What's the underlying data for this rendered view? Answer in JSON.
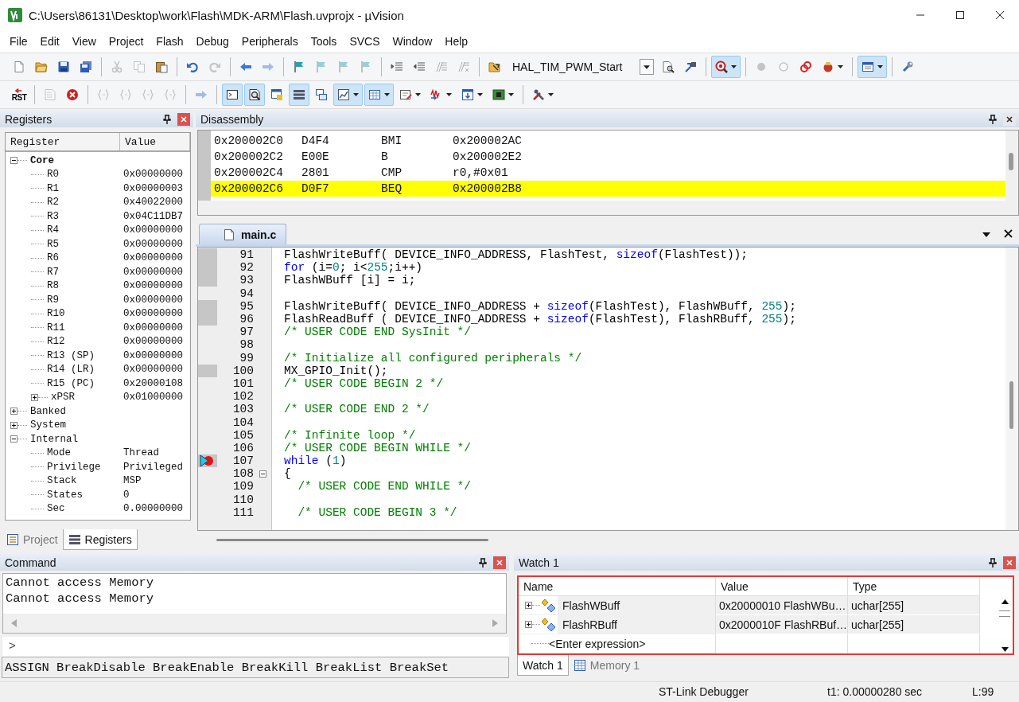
{
  "window": {
    "title": "C:\\Users\\86131\\Desktop\\work\\Flash\\MDK-ARM\\Flash.uvprojx - µVision"
  },
  "menu": [
    {
      "label": "File"
    },
    {
      "label": "Edit"
    },
    {
      "label": "View"
    },
    {
      "label": "Project"
    },
    {
      "label": "Flash"
    },
    {
      "label": "Debug"
    },
    {
      "label": "Peripherals"
    },
    {
      "label": "Tools"
    },
    {
      "label": "SVCS"
    },
    {
      "label": "Window"
    },
    {
      "label": "Help"
    }
  ],
  "toolbar_1": [
    {
      "kind": "page",
      "disabled": false,
      "on": false,
      "dropdown": false
    },
    {
      "kind": "folder",
      "disabled": false,
      "on": false,
      "dropdown": false
    },
    {
      "kind": "disk",
      "disabled": false,
      "on": false,
      "dropdown": false
    },
    {
      "kind": "disks",
      "disabled": false,
      "on": false,
      "dropdown": false
    },
    {
      "kind": "sep"
    },
    {
      "kind": "scissors",
      "disabled": true,
      "on": false,
      "dropdown": false
    },
    {
      "kind": "copy",
      "disabled": true,
      "on": false,
      "dropdown": false
    },
    {
      "kind": "clipboard",
      "disabled": false,
      "on": false,
      "dropdown": false
    },
    {
      "kind": "sep"
    },
    {
      "kind": "undo",
      "disabled": false,
      "on": false,
      "dropdown": false
    },
    {
      "kind": "redo",
      "disabled": true,
      "on": false,
      "dropdown": false
    },
    {
      "kind": "sep"
    },
    {
      "kind": "left",
      "disabled": false,
      "on": false,
      "dropdown": false
    },
    {
      "kind": "right",
      "disabled": true,
      "on": false,
      "dropdown": false
    },
    {
      "kind": "sep"
    },
    {
      "kind": "flag",
      "disabled": false,
      "on": false,
      "dropdown": false
    },
    {
      "kind": "flag",
      "disabled": true,
      "on": false,
      "dropdown": false
    },
    {
      "kind": "flag",
      "disabled": true,
      "on": false,
      "dropdown": false
    },
    {
      "kind": "flag",
      "disabled": true,
      "on": false,
      "dropdown": false
    },
    {
      "kind": "sep"
    },
    {
      "kind": "indent",
      "disabled": false,
      "on": false,
      "dropdown": false
    },
    {
      "kind": "unindent",
      "disabled": false,
      "on": false,
      "dropdown": false
    },
    {
      "kind": "comment",
      "disabled": true,
      "on": false,
      "dropdown": false
    },
    {
      "kind": "uncomment",
      "disabled": true,
      "on": false,
      "dropdown": false
    },
    {
      "kind": "sep"
    },
    {
      "kind": "findfolder",
      "disabled": false,
      "on": false,
      "dropdown": false
    },
    {
      "kind": "combo",
      "text": "HAL_TIM_PWM_Start"
    },
    {
      "kind": "finddoc",
      "disabled": false,
      "on": false,
      "dropdown": false
    },
    {
      "kind": "jump",
      "disabled": false,
      "on": false,
      "dropdown": false
    },
    {
      "kind": "sep"
    },
    {
      "kind": "debug",
      "disabled": false,
      "on": true,
      "dropdown": true
    },
    {
      "kind": "sep"
    },
    {
      "kind": "dot",
      "disabled": true,
      "on": false,
      "dropdown": false
    },
    {
      "kind": "ring",
      "disabled": true,
      "on": false,
      "dropdown": false
    },
    {
      "kind": "rings",
      "disabled": false,
      "on": false,
      "dropdown": false
    },
    {
      "kind": "hand",
      "disabled": false,
      "on": false,
      "dropdown": true
    },
    {
      "kind": "sep"
    },
    {
      "kind": "window",
      "disabled": false,
      "on": true,
      "dropdown": true
    },
    {
      "kind": "sep"
    },
    {
      "kind": "wrench",
      "disabled": false,
      "on": false,
      "dropdown": false
    }
  ],
  "toolbar_2": [
    {
      "kind": "rst",
      "label": "RST",
      "disabled": false,
      "on": false,
      "dropdown": false
    },
    {
      "kind": "sep"
    },
    {
      "kind": "listdoc",
      "disabled": true,
      "on": false,
      "dropdown": false
    },
    {
      "kind": "stop",
      "disabled": false,
      "on": false,
      "dropdown": false
    },
    {
      "kind": "sep"
    },
    {
      "kind": "braces",
      "disabled": true,
      "on": false,
      "dropdown": false
    },
    {
      "kind": "braces",
      "disabled": true,
      "on": false,
      "dropdown": false
    },
    {
      "kind": "braces",
      "disabled": true,
      "on": false,
      "dropdown": false
    },
    {
      "kind": "braces",
      "disabled": true,
      "on": false,
      "dropdown": false
    },
    {
      "kind": "sep"
    },
    {
      "kind": "right",
      "disabled": true,
      "on": false,
      "dropdown": false
    },
    {
      "kind": "sep"
    },
    {
      "kind": "terminal",
      "disabled": false,
      "on": true,
      "dropdown": false
    },
    {
      "kind": "magdoc",
      "disabled": false,
      "on": true,
      "dropdown": false
    },
    {
      "kind": "swin",
      "disabled": false,
      "on": false,
      "dropdown": false
    },
    {
      "kind": "bars",
      "disabled": false,
      "on": true,
      "dropdown": false
    },
    {
      "kind": "windows",
      "disabled": false,
      "on": false,
      "dropdown": false
    },
    {
      "kind": "chart",
      "disabled": false,
      "on": true,
      "dropdown": true
    },
    {
      "kind": "grid",
      "disabled": false,
      "on": true,
      "dropdown": true
    },
    {
      "kind": "editdoc",
      "disabled": false,
      "on": false,
      "dropdown": true
    },
    {
      "kind": "wave",
      "disabled": false,
      "on": false,
      "dropdown": true
    },
    {
      "kind": "memdoc",
      "disabled": false,
      "on": false,
      "dropdown": true
    },
    {
      "kind": "chip",
      "disabled": false,
      "on": false,
      "dropdown": true
    },
    {
      "kind": "sep"
    },
    {
      "kind": "tools",
      "disabled": false,
      "on": false,
      "dropdown": true
    }
  ],
  "registers": {
    "title": "Registers",
    "active": true,
    "columns": [
      "Register",
      "Value"
    ],
    "tree": [
      {
        "name": "Core",
        "expanded": true,
        "emphasized": true,
        "children": [
          {
            "name": "R0",
            "value": "0x00000000"
          },
          {
            "name": "R1",
            "value": "0x00000003"
          },
          {
            "name": "R2",
            "value": "0x40022000"
          },
          {
            "name": "R3",
            "value": "0x04C11DB7"
          },
          {
            "name": "R4",
            "value": "0x00000000"
          },
          {
            "name": "R5",
            "value": "0x00000000"
          },
          {
            "name": "R6",
            "value": "0x00000000"
          },
          {
            "name": "R7",
            "value": "0x00000000"
          },
          {
            "name": "R8",
            "value": "0x00000000"
          },
          {
            "name": "R9",
            "value": "0x00000000"
          },
          {
            "name": "R10",
            "value": "0x00000000"
          },
          {
            "name": "R11",
            "value": "0x00000000"
          },
          {
            "name": "R12",
            "value": "0x00000000"
          },
          {
            "name": "R13 (SP)",
            "value": "0x00000000"
          },
          {
            "name": "R14 (LR)",
            "value": "0x00000000"
          },
          {
            "name": "R15 (PC)",
            "value": "0x20000108"
          },
          {
            "name": "xPSR",
            "value": "0x01000000",
            "expanded": false
          }
        ]
      },
      {
        "name": "Banked",
        "expanded": false,
        "emphasized": false
      },
      {
        "name": "System",
        "expanded": false,
        "emphasized": false
      },
      {
        "name": "Internal",
        "expanded": true,
        "emphasized": false,
        "children": [
          {
            "name": "Mode",
            "value": "Thread"
          },
          {
            "name": "Privilege",
            "value": "Privileged"
          },
          {
            "name": "Stack",
            "value": "MSP"
          },
          {
            "name": "States",
            "value": "0"
          },
          {
            "name": "Sec",
            "value": "0.00000000"
          }
        ]
      }
    ],
    "tabs": [
      {
        "label": "Project",
        "kind": "project",
        "selected": false
      },
      {
        "label": "Registers",
        "kind": "registers",
        "selected": true
      }
    ]
  },
  "disassembly": {
    "title": "Disassembly",
    "active": false,
    "rows": [
      {
        "address": "0x200002C0",
        "opcode": "D4F4",
        "mnemonic": "BMI",
        "operands": "0x200002AC",
        "current": false
      },
      {
        "address": "0x200002C2",
        "opcode": "E00E",
        "mnemonic": "B",
        "operands": "0x200002E2",
        "current": false
      },
      {
        "address": "0x200002C4",
        "opcode": "2801",
        "mnemonic": "CMP",
        "operands": "r0,#0x01",
        "current": false
      },
      {
        "address": "0x200002C6",
        "opcode": "D0F7",
        "mnemonic": "BEQ",
        "operands": "0x200002B8",
        "current": true
      }
    ]
  },
  "editor": {
    "tabs": [
      {
        "label": "main.c",
        "selected": true
      }
    ],
    "lines": [
      {
        "number": "91",
        "executable": true,
        "breakpoint": false,
        "current": false,
        "fold": false,
        "tokens": [
          {
            "kind": "plain",
            "text": "FlashWriteBuff( DEVICE_INFO_ADDRESS, FlashTest, "
          },
          {
            "kind": "keyword",
            "text": "sizeof"
          },
          {
            "kind": "plain",
            "text": "(FlashTest));"
          }
        ]
      },
      {
        "number": "92",
        "executable": true,
        "breakpoint": false,
        "current": false,
        "fold": false,
        "tokens": [
          {
            "kind": "keyword",
            "text": "for"
          },
          {
            "kind": "plain",
            "text": " (i="
          },
          {
            "kind": "number",
            "text": "0"
          },
          {
            "kind": "plain",
            "text": "; i<"
          },
          {
            "kind": "number",
            "text": "255"
          },
          {
            "kind": "plain",
            "text": ";i++)"
          }
        ]
      },
      {
        "number": "93",
        "executable": true,
        "breakpoint": false,
        "current": false,
        "fold": false,
        "tokens": [
          {
            "kind": "plain",
            "text": "FlashWBuff [i] = i;"
          }
        ]
      },
      {
        "number": "94",
        "executable": false,
        "breakpoint": false,
        "current": false,
        "fold": false
      },
      {
        "number": "95",
        "executable": true,
        "breakpoint": false,
        "current": false,
        "fold": false,
        "tokens": [
          {
            "kind": "plain",
            "text": "FlashWriteBuff( DEVICE_INFO_ADDRESS + "
          },
          {
            "kind": "keyword",
            "text": "sizeof"
          },
          {
            "kind": "plain",
            "text": "(FlashTest), FlashWBuff, "
          },
          {
            "kind": "number",
            "text": "255"
          },
          {
            "kind": "plain",
            "text": ");"
          }
        ]
      },
      {
        "number": "96",
        "executable": true,
        "breakpoint": false,
        "current": false,
        "fold": false,
        "tokens": [
          {
            "kind": "plain",
            "text": "FlashReadBuff ( DEVICE_INFO_ADDRESS + "
          },
          {
            "kind": "keyword",
            "text": "sizeof"
          },
          {
            "kind": "plain",
            "text": "(FlashTest), FlashRBuff, "
          },
          {
            "kind": "number",
            "text": "255"
          },
          {
            "kind": "plain",
            "text": ");"
          }
        ]
      },
      {
        "number": "97",
        "executable": false,
        "breakpoint": false,
        "current": false,
        "fold": false,
        "tokens": [
          {
            "kind": "comment",
            "text": "/* USER CODE END SysInit */"
          }
        ]
      },
      {
        "number": "98",
        "executable": false,
        "breakpoint": false,
        "current": false,
        "fold": false
      },
      {
        "number": "99",
        "executable": false,
        "breakpoint": false,
        "current": false,
        "fold": false,
        "tokens": [
          {
            "kind": "comment",
            "text": "/* Initialize all configured peripherals */"
          }
        ]
      },
      {
        "number": "100",
        "executable": true,
        "breakpoint": false,
        "current": false,
        "fold": false,
        "tokens": [
          {
            "kind": "plain",
            "text": "MX_GPIO_Init();"
          }
        ]
      },
      {
        "number": "101",
        "executable": false,
        "breakpoint": false,
        "current": false,
        "fold": false,
        "tokens": [
          {
            "kind": "comment",
            "text": "/* USER CODE BEGIN 2 */"
          }
        ]
      },
      {
        "number": "102",
        "executable": false,
        "breakpoint": false,
        "current": false,
        "fold": false
      },
      {
        "number": "103",
        "executable": false,
        "breakpoint": false,
        "current": false,
        "fold": false,
        "tokens": [
          {
            "kind": "comment",
            "text": "/* USER CODE END 2 */"
          }
        ]
      },
      {
        "number": "104",
        "executable": false,
        "breakpoint": false,
        "current": false,
        "fold": false
      },
      {
        "number": "105",
        "executable": false,
        "breakpoint": false,
        "current": false,
        "fold": false,
        "tokens": [
          {
            "kind": "comment",
            "text": "/* Infinite loop */"
          }
        ]
      },
      {
        "number": "106",
        "executable": false,
        "breakpoint": false,
        "current": false,
        "fold": false,
        "tokens": [
          {
            "kind": "comment",
            "text": "/* USER CODE BEGIN WHILE */"
          }
        ]
      },
      {
        "number": "107",
        "executable": true,
        "breakpoint": true,
        "current": true,
        "fold": false,
        "tokens": [
          {
            "kind": "keyword",
            "text": "while"
          },
          {
            "kind": "plain",
            "text": " ("
          },
          {
            "kind": "number",
            "text": "1"
          },
          {
            "kind": "plain",
            "text": ")"
          }
        ]
      },
      {
        "number": "108",
        "executable": false,
        "breakpoint": false,
        "current": false,
        "fold": true,
        "tokens": [
          {
            "kind": "plain",
            "text": "{"
          }
        ]
      },
      {
        "number": "109",
        "executable": false,
        "breakpoint": false,
        "current": false,
        "fold": false,
        "tokens": [
          {
            "kind": "comment",
            "text": "  /* USER CODE END WHILE */"
          }
        ]
      },
      {
        "number": "110",
        "executable": false,
        "breakpoint": false,
        "current": false,
        "fold": false
      },
      {
        "number": "111",
        "executable": false,
        "breakpoint": false,
        "current": false,
        "fold": false,
        "tokens": [
          {
            "kind": "comment",
            "text": "  /* USER CODE BEGIN 3 */"
          }
        ]
      }
    ]
  },
  "command": {
    "title": "Command",
    "active": true,
    "output": [
      "Cannot access Memory",
      "Cannot access Memory"
    ],
    "prompt": ">",
    "hint": "ASSIGN BreakDisable BreakEnable BreakKill BreakList BreakSet"
  },
  "watch": {
    "title": "Watch 1",
    "active": true,
    "columns": [
      "Name",
      "Value",
      "Type"
    ],
    "rows": [
      {
        "name": "FlashWBuff",
        "value": "0x20000010 FlashWBu…",
        "type": "uchar[255]",
        "expanded": false
      },
      {
        "name": "FlashRBuff",
        "value": "0x2000010F FlashRBuf…",
        "type": "uchar[255]",
        "expanded": false
      }
    ],
    "new_row": "<Enter expression>",
    "tabs": [
      {
        "label": "Watch 1",
        "kind": "watch",
        "selected": true
      },
      {
        "label": "Memory 1",
        "kind": "memory",
        "selected": false
      }
    ]
  },
  "status_bar": [
    "ST-Link Debugger",
    "t1: 0.00000280 sec",
    "L:99"
  ]
}
